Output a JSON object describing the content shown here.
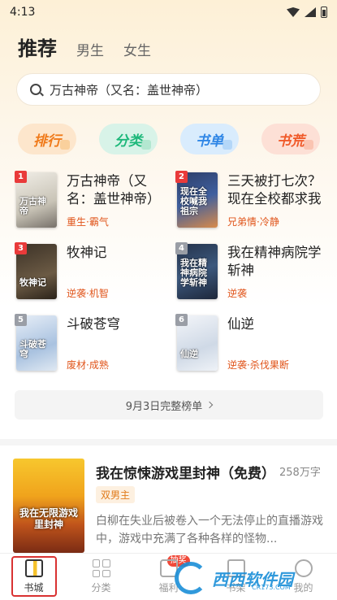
{
  "status_bar": {
    "time": "4:13"
  },
  "header": {
    "tabs": [
      {
        "label": "推荐"
      },
      {
        "label": "男生"
      },
      {
        "label": "女生"
      }
    ]
  },
  "search": {
    "text": "万古神帝（又名：盖世神帝）"
  },
  "categories": [
    {
      "label": "排行"
    },
    {
      "label": "分类"
    },
    {
      "label": "书单"
    },
    {
      "label": "书荒"
    }
  ],
  "ranking": {
    "items": [
      {
        "rank": "1",
        "title": "万古神帝（又名：盖世神帝）",
        "tags": "重生·霸气",
        "cover_text": "万古神帝"
      },
      {
        "rank": "2",
        "title": "三天被打七次？现在全校都求我要点",
        "tags": "兄弟情·冷静",
        "cover_text": "现在全校喊我祖宗"
      },
      {
        "rank": "3",
        "title": "牧神记",
        "tags": "逆袭·机智",
        "cover_text": "牧神记"
      },
      {
        "rank": "4",
        "title": "我在精神病院学斩神",
        "tags": "逆袭",
        "cover_text": "我在精神病院学斩神"
      },
      {
        "rank": "5",
        "title": "斗破苍穹",
        "tags": "废材·成熟",
        "cover_text": "斗破苍穹"
      },
      {
        "rank": "6",
        "title": "仙逆",
        "tags": "逆袭·杀伐果断",
        "cover_text": "仙逆"
      }
    ],
    "full_list_label": "9月3日完整榜单"
  },
  "featured": {
    "title": "我在惊悚游戏里封神（免费）",
    "word_count": "258万字",
    "tag": "双男主",
    "description": "白柳在失业后被卷入一个无法停止的直播游戏中，游戏中充满了各种各样的怪物...",
    "cover_text": "我在无限游戏里封神"
  },
  "bottom_nav": {
    "items": [
      {
        "label": "书城"
      },
      {
        "label": "分类"
      },
      {
        "label": "福利",
        "badge": "抽奖"
      },
      {
        "label": "书架"
      },
      {
        "label": "我的"
      }
    ]
  },
  "watermark": {
    "text": "西西软件园",
    "sub": "CR173.COM"
  },
  "colors": {
    "accent": "#d93232",
    "orange": "#f07a1a",
    "tag_color": "#e0541a"
  }
}
